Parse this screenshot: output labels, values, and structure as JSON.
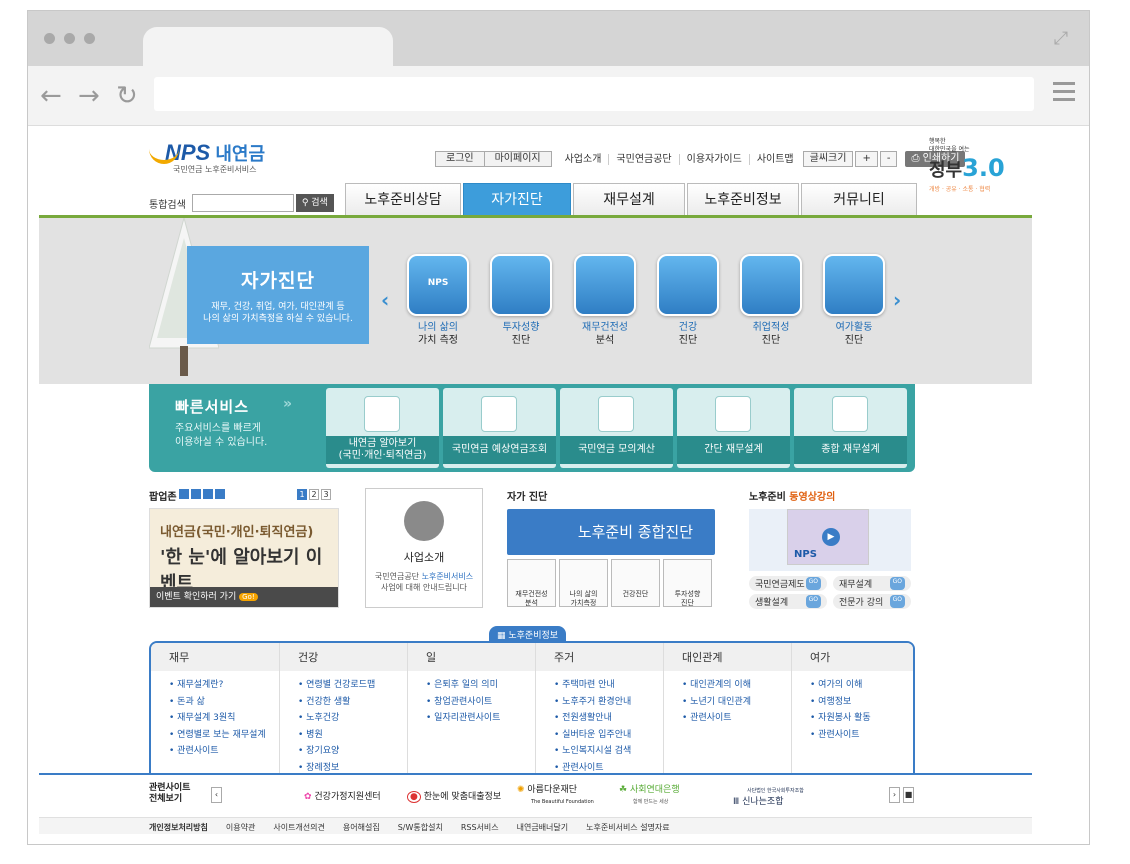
{
  "util": {
    "login": "로그인",
    "mypage": "마이페이지",
    "links": [
      "사업소개",
      "국민연금공단",
      "이용자가이드",
      "사이트맵"
    ],
    "fontsize": "글씨크기",
    "plus": "+",
    "minus": "-",
    "print": "인쇄하기"
  },
  "logo": {
    "nps": "NPS",
    "name": "내연금",
    "sub": "국민연금 노후준비서비스"
  },
  "gov": {
    "small1": "행복한",
    "small2": "대한민국을 여는",
    "big": "정부",
    "ver": "3.0",
    "tags": "개방 · 공유 · 소통 · 협력"
  },
  "search": {
    "label": "통합검색",
    "button": "검색"
  },
  "gnb": [
    "노후준비상담",
    "자가진단",
    "재무설계",
    "노후준비정보",
    "커뮤니티"
  ],
  "hero": {
    "title": "자가진단",
    "desc1": "재무, 건강, 취업, 여가, 대인관계 등",
    "desc2": "나의 삶의 가치측정을 하실 수 있습니다.",
    "items": [
      {
        "t1": "나의 삶의",
        "t2": "가치 측정",
        "badge": "NPS"
      },
      {
        "t1": "투자성향",
        "t2": "진단"
      },
      {
        "t1": "재무건전성",
        "t2": "분석"
      },
      {
        "t1": "건강",
        "t2": "진단"
      },
      {
        "t1": "취업적성",
        "t2": "진단"
      },
      {
        "t1": "여가활동",
        "t2": "진단"
      }
    ]
  },
  "quick": {
    "title": "빠른서비스",
    "desc1": "주요서비스를 빠르게",
    "desc2": "이용하실 수 있습니다.",
    "items": [
      {
        "l1": "내연금 알아보기",
        "l2": "(국민·개인·퇴직연금)"
      },
      {
        "l1": "국민연금 예상연금조회"
      },
      {
        "l1": "국민연금 모의계산"
      },
      {
        "l1": "간단 재무설계"
      },
      {
        "l1": "종합 재무설계"
      }
    ]
  },
  "popup": {
    "title": "팝업존",
    "pages": [
      "1",
      "2",
      "3"
    ],
    "banner1": "내연금(국민·개인·퇴직연금)",
    "banner2": "'한 눈'에 알아보기 이벤트",
    "foot": "이벤트 확인하러 가기",
    "go": "Go!"
  },
  "card": {
    "title": "사업소개",
    "d1": "국민연금공단",
    "d2": "노후준비서비스",
    "d3": "사업에 대해 안내드립니다"
  },
  "selfdiag": {
    "title": "자가 진단",
    "main": "노후준비 종합진단",
    "items": [
      {
        "l1": "재무건전성",
        "l2": "분석"
      },
      {
        "l1": "나의 삶의",
        "l2": "가치측정"
      },
      {
        "l1": "건강진단",
        "l2": ""
      },
      {
        "l1": "투자성향",
        "l2": "진단"
      }
    ]
  },
  "vod": {
    "title": "노후준비",
    "title_hl": "동영상강의",
    "nps": "NPS",
    "links": [
      "국민연금제도",
      "재무설계",
      "생활설계",
      "전문가 강의"
    ],
    "go": "GO"
  },
  "info_tag": "노후준비정보",
  "info": [
    {
      "h": "재무",
      "items": [
        "재무설계란?",
        "돈과 삶",
        "재무설계 3원칙",
        "연령별로 보는 재무설계",
        "관련사이트"
      ]
    },
    {
      "h": "건강",
      "items": [
        "연령별 건강로드맵",
        "건강한 생활",
        "노후건강",
        "병원",
        "장기요양",
        "장례정보"
      ]
    },
    {
      "h": "일",
      "items": [
        "은퇴후 일의 의미",
        "창업관련사이트",
        "일자리관련사이트"
      ]
    },
    {
      "h": "주거",
      "items": [
        "주택마련 안내",
        "노후주거 환경안내",
        "전원생활안내",
        "실버타운 입주안내",
        "노인복지시설 검색",
        "관련사이트"
      ]
    },
    {
      "h": "대인관계",
      "items": [
        "대인관계의 이해",
        "노년기 대인관계",
        "관련사이트"
      ]
    },
    {
      "h": "여가",
      "items": [
        "여가의 이해",
        "여행정보",
        "자원봉사 활동",
        "관련사이트"
      ]
    }
  ],
  "related": {
    "l1": "관련사이트",
    "l2": "전체보기",
    "logos": [
      "건강가정지원센터",
      "한눈에 맞춤대출정보",
      "아름다운재단",
      "사회연대은행",
      "신나는조합"
    ],
    "sub3": "The Beautiful Foundation",
    "sub4": "함께 만드는 세상",
    "pre5": "사단법인 한국사회투자조합"
  },
  "footer": [
    "개인정보처리방침",
    "이용약관",
    "사이트개선의견",
    "용어해설집",
    "S/W통합설치",
    "RSS서비스",
    "내연금배너달기",
    "노후준비서비스 설명자료"
  ],
  "colors": {
    "accent": "#3a7cc6",
    "quick": "#3aa3a3",
    "green": "#78a93c"
  }
}
